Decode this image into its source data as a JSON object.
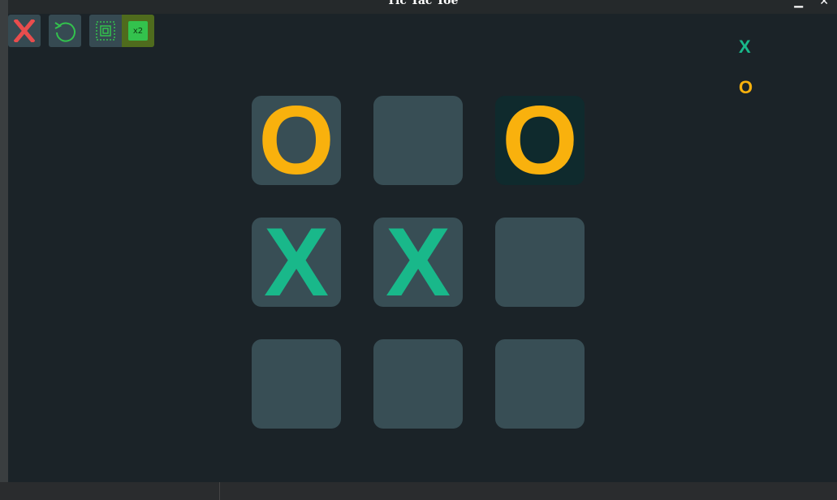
{
  "window": {
    "title": "Tic Tac Toe"
  },
  "toolbar": {
    "speed_label": "x2"
  },
  "legend": {
    "player_x": "X",
    "player_o": "O"
  },
  "board": {
    "cells": [
      "O",
      "",
      "O",
      "X",
      "X",
      "",
      "",
      "",
      ""
    ],
    "highlighted_cell": 2
  },
  "colors": {
    "x_color": "#19b88a",
    "o_color": "#f9b10d",
    "cell_bg": "#384e55",
    "highlight_bg": "#0f2a2d",
    "window_bg": "#1b2328",
    "close_button_color": "#e84d4d",
    "reload_icon_color": "#33c24d"
  },
  "icons": {
    "close_game": "close-x-icon",
    "restart": "refresh-icon",
    "fit": "fit-to-screen-icon",
    "speed": "speed-x2-icon"
  }
}
